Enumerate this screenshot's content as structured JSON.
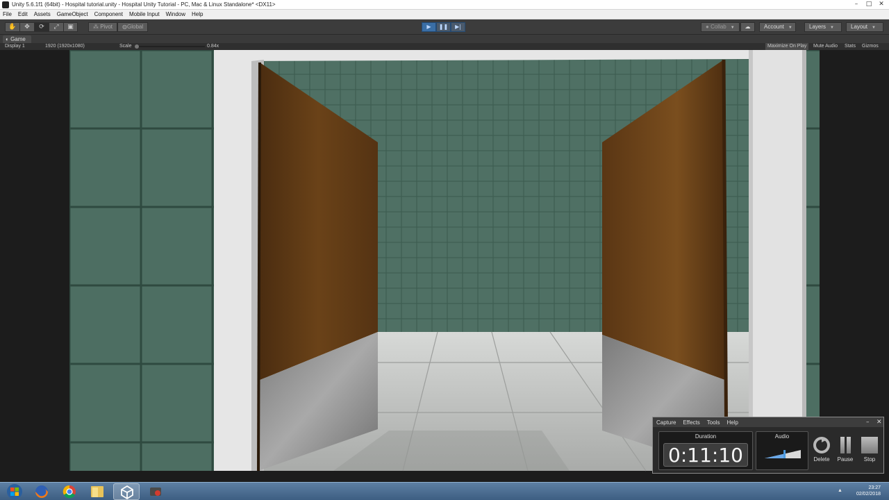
{
  "window": {
    "title": "Unity 5.6.1f1 (64bit) - Hospital tutorial.unity - Hospital Unity Tutorial - PC, Mac & Linux Standalone* <DX11>",
    "controls": {
      "minimize": "–",
      "maximize": "□",
      "close": "✕"
    }
  },
  "menubar": {
    "items": [
      "File",
      "Edit",
      "Assets",
      "GameObject",
      "Component",
      "Mobile Input",
      "Window",
      "Help"
    ]
  },
  "toolbar": {
    "transform_tools": [
      "hand-icon",
      "move-icon",
      "rotate-icon",
      "scale-icon",
      "rect-icon"
    ],
    "pivot_label": "Pivot",
    "global_label": "Global",
    "play_controls": [
      "play-icon",
      "pause-icon",
      "step-icon"
    ],
    "collab_label": "Collab",
    "account_label": "Account",
    "layers_label": "Layers",
    "layout_label": "Layout"
  },
  "game_view": {
    "tab_label": "Game",
    "display_label": "Display 1",
    "resolution_label": "1920 (1920x1080)",
    "scale_label": "Scale",
    "scale_value": "0.84x",
    "maximize_label": "Maximize On Play",
    "mute_label": "Mute Audio",
    "stats_label": "Stats",
    "gizmos_label": "Gizmos"
  },
  "recorder": {
    "menu": [
      "Capture",
      "Effects",
      "Tools",
      "Help"
    ],
    "duration_label": "Duration",
    "duration_value": "0:11:10",
    "audio_label": "Audio",
    "audio_level": 0.55,
    "delete_label": "Delete",
    "pause_label": "Pause",
    "stop_label": "Stop"
  },
  "taskbar": {
    "apps": [
      "windows-start-icon",
      "firefox-icon",
      "chrome-icon",
      "file-explorer-icon",
      "unity-icon",
      "recorder-app-icon"
    ],
    "active_app": "unity-icon",
    "time": "23:27",
    "date": "02/02/2018"
  },
  "colors": {
    "tile_green": "#4d6e62",
    "door_wood": "#5e3a16",
    "floor": "#c6c8c6",
    "frame_white": "#e4e4e4",
    "play_blue": "#3a6ea5"
  }
}
